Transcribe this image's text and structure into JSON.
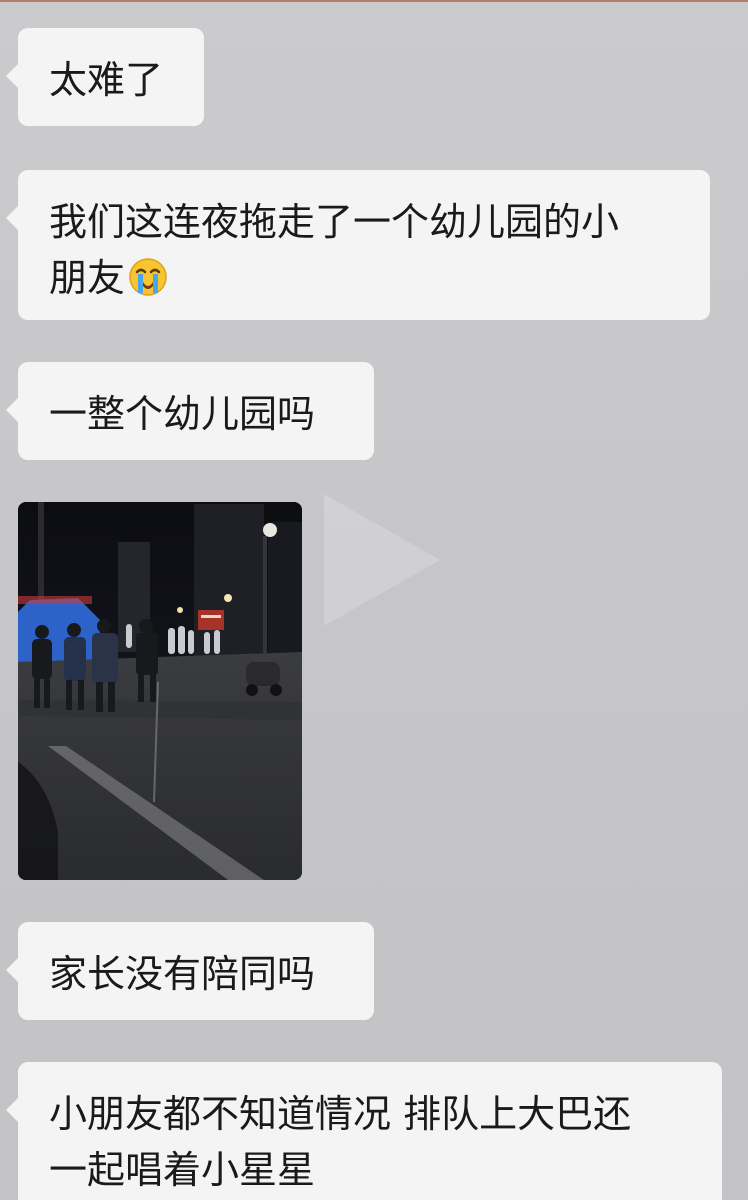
{
  "messages": [
    {
      "type": "text",
      "text": "太难了"
    },
    {
      "type": "text",
      "line1": "我们这连夜拖走了一个幼儿园的小",
      "line2": "朋友",
      "emoji": "loudly-crying-face-icon"
    },
    {
      "type": "text",
      "text": "一整个幼儿园吗"
    },
    {
      "type": "image",
      "content": "night-street-photo",
      "overlay_icon": "play-icon"
    },
    {
      "type": "text",
      "text": "家长没有陪同吗"
    },
    {
      "type": "text",
      "line1": "小朋友都不知道情况 排队上大巴还",
      "line2": "一起唱着小星星"
    }
  ],
  "colors": {
    "background": "#c8c8ca",
    "bubble": "#f4f4f4",
    "text": "#1a1a1a",
    "top_accent": "#b87a6a"
  }
}
